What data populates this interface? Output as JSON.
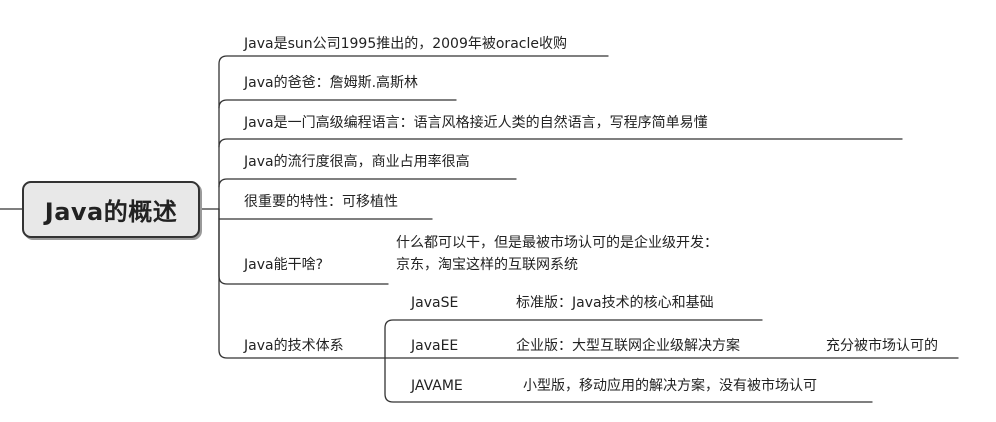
{
  "central": "Java的概述",
  "branches": [
    "Java是sun公司1995推出的，2009年被oracle收购",
    "Java的爸爸：詹姆斯.高斯林",
    "Java是一门高级编程语言：语言风格接近人类的自然语言，写程序简单易懂",
    "Java的流行度很高，商业占用率很高",
    "很重要的特性：可移植性"
  ],
  "can_do": {
    "label": "Java能干啥?",
    "line1": "什么都可以干，但是最被市场认可的是企业级开发：",
    "line2": "京东，淘宝这样的互联网系统"
  },
  "tech": {
    "label": "Java的技术体系",
    "items": [
      {
        "name": "JavaSE",
        "desc": "标准版：Java技术的核心和基础",
        "note": ""
      },
      {
        "name": "JavaEE",
        "desc": "企业版：大型互联网企业级解决方案",
        "note": "充分被市场认可的"
      },
      {
        "name": "JAVAME",
        "desc": "小型版，移动应用的解决方案，没有被市场认可",
        "note": ""
      }
    ]
  }
}
